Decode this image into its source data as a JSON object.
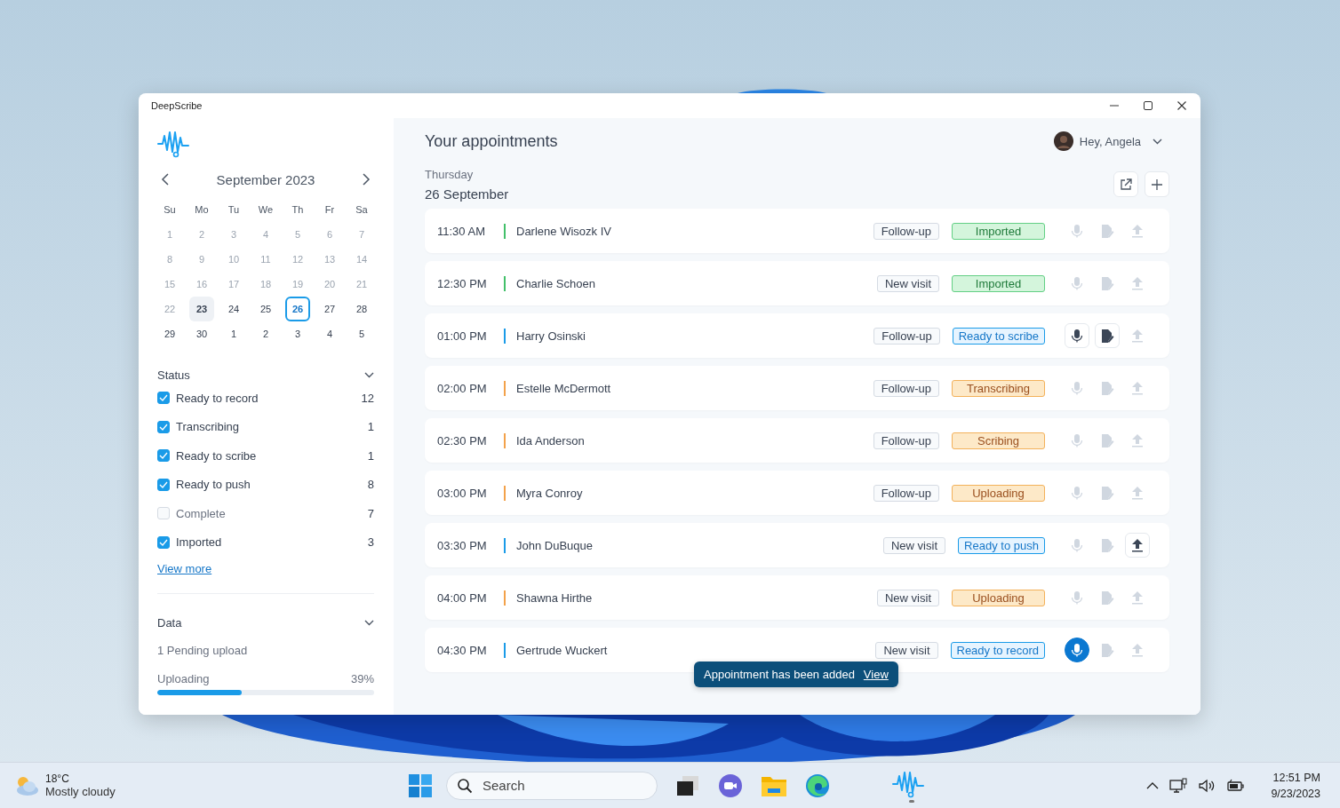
{
  "window": {
    "title": "DeepScribe"
  },
  "calendar": {
    "month": "September 2023",
    "weekdays": [
      "Su",
      "Mo",
      "Tu",
      "We",
      "Th",
      "Fr",
      "Sa"
    ],
    "days": [
      {
        "label": "1",
        "muted": true,
        "today": false,
        "selected": false
      },
      {
        "label": "2",
        "muted": true,
        "today": false,
        "selected": false
      },
      {
        "label": "3",
        "muted": true,
        "today": false,
        "selected": false
      },
      {
        "label": "4",
        "muted": true,
        "today": false,
        "selected": false
      },
      {
        "label": "5",
        "muted": true,
        "today": false,
        "selected": false
      },
      {
        "label": "6",
        "muted": true,
        "today": false,
        "selected": false
      },
      {
        "label": "7",
        "muted": true,
        "today": false,
        "selected": false
      },
      {
        "label": "8",
        "muted": true,
        "today": false,
        "selected": false
      },
      {
        "label": "9",
        "muted": true,
        "today": false,
        "selected": false
      },
      {
        "label": "10",
        "muted": true,
        "today": false,
        "selected": false
      },
      {
        "label": "11",
        "muted": true,
        "today": false,
        "selected": false
      },
      {
        "label": "12",
        "muted": true,
        "today": false,
        "selected": false
      },
      {
        "label": "13",
        "muted": true,
        "today": false,
        "selected": false
      },
      {
        "label": "14",
        "muted": true,
        "today": false,
        "selected": false
      },
      {
        "label": "15",
        "muted": true,
        "today": false,
        "selected": false
      },
      {
        "label": "16",
        "muted": true,
        "today": false,
        "selected": false
      },
      {
        "label": "17",
        "muted": true,
        "today": false,
        "selected": false
      },
      {
        "label": "18",
        "muted": true,
        "today": false,
        "selected": false
      },
      {
        "label": "19",
        "muted": true,
        "today": false,
        "selected": false
      },
      {
        "label": "20",
        "muted": true,
        "today": false,
        "selected": false
      },
      {
        "label": "21",
        "muted": true,
        "today": false,
        "selected": false
      },
      {
        "label": "22",
        "muted": true,
        "today": false,
        "selected": false
      },
      {
        "label": "23",
        "muted": false,
        "today": true,
        "selected": false
      },
      {
        "label": "24",
        "muted": false,
        "today": false,
        "selected": false
      },
      {
        "label": "25",
        "muted": false,
        "today": false,
        "selected": false
      },
      {
        "label": "26",
        "muted": false,
        "today": false,
        "selected": true
      },
      {
        "label": "27",
        "muted": false,
        "today": false,
        "selected": false
      },
      {
        "label": "28",
        "muted": false,
        "today": false,
        "selected": false
      },
      {
        "label": "29",
        "muted": false,
        "today": false,
        "selected": false
      },
      {
        "label": "30",
        "muted": false,
        "today": false,
        "selected": false
      },
      {
        "label": "1",
        "muted": false,
        "today": false,
        "selected": false
      },
      {
        "label": "2",
        "muted": false,
        "today": false,
        "selected": false
      },
      {
        "label": "3",
        "muted": false,
        "today": false,
        "selected": false
      },
      {
        "label": "4",
        "muted": false,
        "today": false,
        "selected": false
      },
      {
        "label": "5",
        "muted": false,
        "today": false,
        "selected": false
      }
    ]
  },
  "status_filter": {
    "title": "Status",
    "items": [
      {
        "label": "Ready to record",
        "count": "12",
        "checked": true
      },
      {
        "label": "Transcribing",
        "count": "1",
        "checked": true
      },
      {
        "label": "Ready to scribe",
        "count": "1",
        "checked": true
      },
      {
        "label": "Ready to push",
        "count": "8",
        "checked": true
      },
      {
        "label": "Complete",
        "count": "7",
        "checked": false
      },
      {
        "label": "Imported",
        "count": "3",
        "checked": true
      }
    ],
    "link": "View more"
  },
  "data_section": {
    "title": "Data",
    "pending": "1 Pending upload",
    "upload_label": "Uploading",
    "upload_reading": "39%",
    "level": 0.39
  },
  "header": {
    "title": "Your appointments",
    "greeting": "Hey, Angela",
    "weekday": "Thursday",
    "date": "26 September"
  },
  "appointments": [
    {
      "time": "11:30 AM",
      "name": "Darlene Wisozk IV",
      "type": "Follow-up",
      "status": "Imported",
      "kind": "done",
      "actions": [
        {
          "kind": "record",
          "enabled": false,
          "primary": false
        },
        {
          "kind": "scribe",
          "enabled": false,
          "primary": false
        },
        {
          "kind": "push",
          "enabled": false,
          "primary": false
        }
      ]
    },
    {
      "time": "12:30 PM",
      "name": "Charlie Schoen",
      "type": "New visit",
      "status": "Imported",
      "kind": "done",
      "actions": [
        {
          "kind": "record",
          "enabled": false,
          "primary": false
        },
        {
          "kind": "scribe",
          "enabled": false,
          "primary": false
        },
        {
          "kind": "push",
          "enabled": false,
          "primary": false
        }
      ]
    },
    {
      "time": "01:00 PM",
      "name": "Harry Osinski",
      "type": "Follow-up",
      "status": "Ready to scribe",
      "kind": "ready",
      "actions": [
        {
          "kind": "record",
          "enabled": true,
          "primary": false
        },
        {
          "kind": "scribe",
          "enabled": true,
          "primary": false
        },
        {
          "kind": "push",
          "enabled": false,
          "primary": false
        }
      ]
    },
    {
      "time": "02:00 PM",
      "name": "Estelle McDermott",
      "type": "Follow-up",
      "status": "Transcribing",
      "kind": "busy",
      "actions": [
        {
          "kind": "record",
          "enabled": false,
          "primary": false
        },
        {
          "kind": "scribe",
          "enabled": false,
          "primary": false
        },
        {
          "kind": "push",
          "enabled": false,
          "primary": false
        }
      ]
    },
    {
      "time": "02:30 PM",
      "name": "Ida Anderson",
      "type": "Follow-up",
      "status": "Scribing",
      "kind": "busy",
      "actions": [
        {
          "kind": "record",
          "enabled": false,
          "primary": false
        },
        {
          "kind": "scribe",
          "enabled": false,
          "primary": false
        },
        {
          "kind": "push",
          "enabled": false,
          "primary": false
        }
      ]
    },
    {
      "time": "03:00 PM",
      "name": "Myra Conroy",
      "type": "Follow-up",
      "status": "Uploading",
      "kind": "busy",
      "actions": [
        {
          "kind": "record",
          "enabled": false,
          "primary": false
        },
        {
          "kind": "scribe",
          "enabled": false,
          "primary": false
        },
        {
          "kind": "push",
          "enabled": false,
          "primary": false
        }
      ]
    },
    {
      "time": "03:30 PM",
      "name": "John DuBuque",
      "type": "New visit",
      "status": "Ready to push",
      "kind": "ready",
      "actions": [
        {
          "kind": "record",
          "enabled": false,
          "primary": false
        },
        {
          "kind": "scribe",
          "enabled": false,
          "primary": false
        },
        {
          "kind": "push",
          "enabled": true,
          "primary": false
        }
      ]
    },
    {
      "time": "04:00 PM",
      "name": "Shawna Hirthe",
      "type": "New visit",
      "status": "Uploading",
      "kind": "busy",
      "actions": [
        {
          "kind": "record",
          "enabled": false,
          "primary": false
        },
        {
          "kind": "scribe",
          "enabled": false,
          "primary": false
        },
        {
          "kind": "push",
          "enabled": false,
          "primary": false
        }
      ]
    },
    {
      "time": "04:30 PM",
      "name": "Gertrude Wuckert",
      "type": "New visit",
      "status": "Ready to record",
      "kind": "ready",
      "actions": [
        {
          "kind": "record",
          "enabled": true,
          "primary": true
        },
        {
          "kind": "scribe",
          "enabled": false,
          "primary": false
        },
        {
          "kind": "push",
          "enabled": false,
          "primary": false
        }
      ]
    }
  ],
  "toast": {
    "message": "Appointment has been added",
    "link": "View"
  },
  "taskbar": {
    "temperature": "18°C",
    "weather": "Mostly cloudy",
    "search": {
      "placeholder": "Search"
    },
    "time": "12:51 PM",
    "date": "9/23/2023"
  }
}
